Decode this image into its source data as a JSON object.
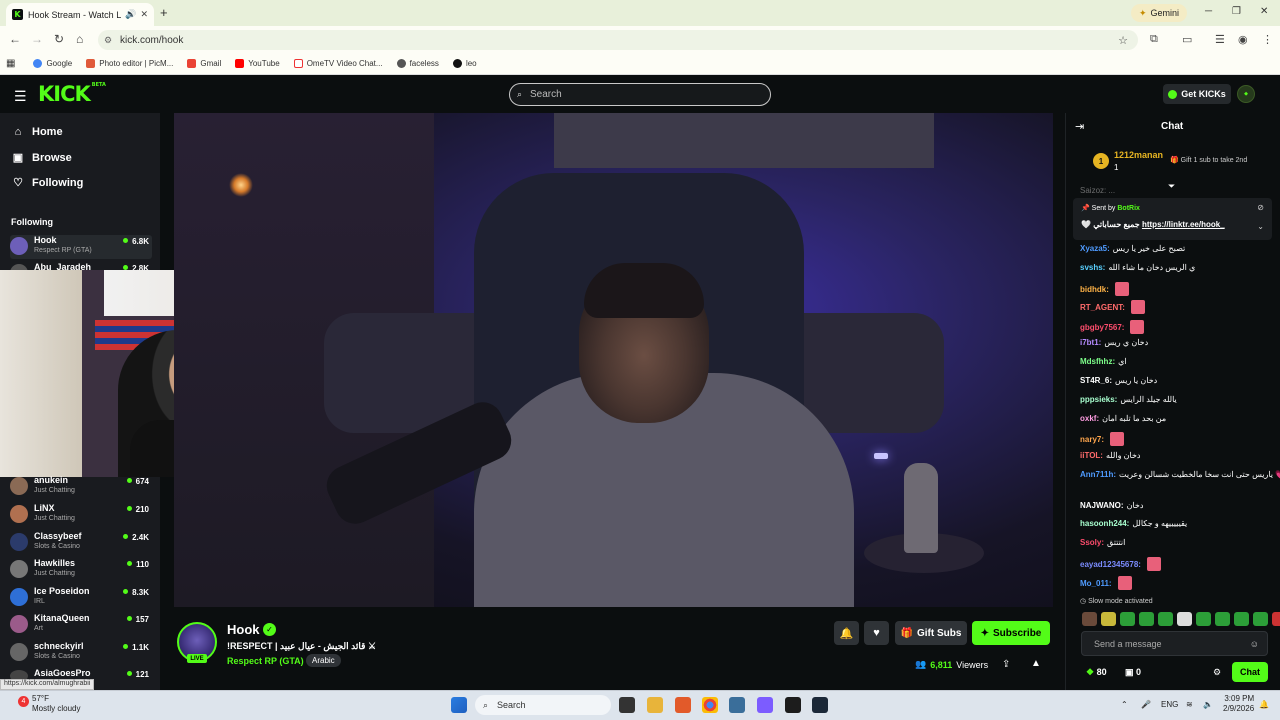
{
  "browser": {
    "tab_title": "Hook Stream - Watch Live o",
    "new_tab": "+",
    "gemini_label": "Gemini",
    "url": "kick.com/hook",
    "bookmarks": [
      "Google",
      "Photo editor | PicM...",
      "Gmail",
      "YouTube",
      "OmeTV Video Chat...",
      "faceless",
      "leo"
    ]
  },
  "header": {
    "logo": "KICK",
    "logo_beta": "BETA",
    "search_placeholder": "Search",
    "get_kicks": "Get KICKs"
  },
  "sidebar": {
    "nav": [
      "Home",
      "Browse",
      "Following"
    ],
    "section_title": "Following",
    "channels": [
      {
        "name": "Hook",
        "category": "Respect RP (GTA)",
        "viewers": "6.8K",
        "color": "#6d5fb9"
      },
      {
        "name": "Abu_Jaradeh",
        "category": "",
        "viewers": "2.8K",
        "color": "#555555"
      },
      {
        "name": "anukein",
        "category": "Just Chatting",
        "viewers": "674",
        "color": "#8a6a55"
      },
      {
        "name": "LiNX",
        "category": "Just Chatting",
        "viewers": "210",
        "color": "#b07050"
      },
      {
        "name": "Classybeef",
        "category": "Slots & Casino",
        "viewers": "2.4K",
        "color": "#2b3b6b"
      },
      {
        "name": "Hawkilles",
        "category": "Just Chatting",
        "viewers": "110",
        "color": "#777777"
      },
      {
        "name": "Ice Poseidon",
        "category": "IRL",
        "viewers": "8.3K",
        "color": "#2e6fd6"
      },
      {
        "name": "KitanaQueen",
        "category": "Art",
        "viewers": "157",
        "color": "#9b5b8a"
      },
      {
        "name": "schneckyirl",
        "category": "Slots & Casino",
        "viewers": "1.1K",
        "color": "#666666"
      },
      {
        "name": "AsiaGoesPro",
        "category": "",
        "viewers": "121",
        "color": "#444444"
      }
    ],
    "hover_link": "https://kick.com/almughrabii"
  },
  "stream": {
    "name": "Hook",
    "live_badge": "LIVE",
    "title": "!RESPECT | قائد الجيش - عيال عبيد ⚔",
    "category": "Respect RP (GTA)",
    "tag": "Arabic",
    "gift_subs": "Gift Subs",
    "subscribe": "Subscribe",
    "viewers_count": "6,811",
    "viewers_label": "Viewers"
  },
  "chat": {
    "title": "Chat",
    "top_gifter": {
      "rank": "1",
      "name": "1212manan",
      "count": "1",
      "gift_text": "Gift 1 sub to take 2nd"
    },
    "pinned_partial": "Saizoz: ...",
    "sent_by": {
      "prefix": "Sent by",
      "bot": "BotRix",
      "text": "جميع حساباتي",
      "link": "https://linktr.ee/hook_"
    },
    "messages": [
      {
        "user": "Xyaza5:",
        "text": "تصبح على خير يا ريس",
        "color": "#4f9bff"
      },
      {
        "user": "svshs:",
        "text": "ي الريس دخان ما شاء الله",
        "color": "#59d0ff"
      },
      {
        "user": "bidhdk:",
        "text": "",
        "color": "#ffb347"
      },
      {
        "user": "RT_AGENT:",
        "text": "",
        "color": "#ff6b6b"
      },
      {
        "user": "gbgby7567:",
        "text": "",
        "color": "#ff4d6d"
      },
      {
        "user": "i7bt1:",
        "text": "دخان ي ريس",
        "color": "#b58bff"
      },
      {
        "user": "Mdsfhhz:",
        "text": "اي",
        "color": "#7dff8a"
      },
      {
        "user": "ST4R_6:",
        "text": "دخان يا ريس",
        "color": "#ffffff"
      },
      {
        "user": "pppsieks:",
        "text": "يالله جيلد الرايس",
        "color": "#a8ffcf"
      },
      {
        "user": "oxkf:",
        "text": "من بحد ما تلبه امان",
        "color": "#ff9de2"
      },
      {
        "user": "nary7:",
        "text": "",
        "color": "#ffa64d"
      },
      {
        "user": "iiTOL:",
        "text": "دخان والله",
        "color": "#ff6b6b"
      },
      {
        "user": "Ann711h:",
        "text": "ياريس حتى انت سخا مالخطيت شسالن وعريت 💗",
        "color": "#4f9bff"
      },
      {
        "user": "NAJWANO:",
        "text": "دخان",
        "color": "#ffffff"
      },
      {
        "user": "hasoonh244:",
        "text": "يقيييييهه و جكالل",
        "color": "#a8ffcf"
      },
      {
        "user": "Ssoly:",
        "text": "انتتتق",
        "color": "#ff4d6d"
      },
      {
        "user": "eayad12345678:",
        "text": "",
        "color": "#7b8cff"
      },
      {
        "user": "Mo_011:",
        "text": "",
        "color": "#4f9bff"
      }
    ],
    "slow_mode": "Slow mode activated",
    "input_placeholder": "Send a message",
    "kicks_count": "80",
    "zero_count": "0",
    "chat_button": "Chat"
  },
  "taskbar": {
    "weather_temp": "57°F",
    "weather_desc": "Mostly cloudy",
    "weather_badge": "4",
    "search": "Search",
    "lang": "ENG",
    "time": "3:09 PM",
    "date": "2/9/2026"
  }
}
